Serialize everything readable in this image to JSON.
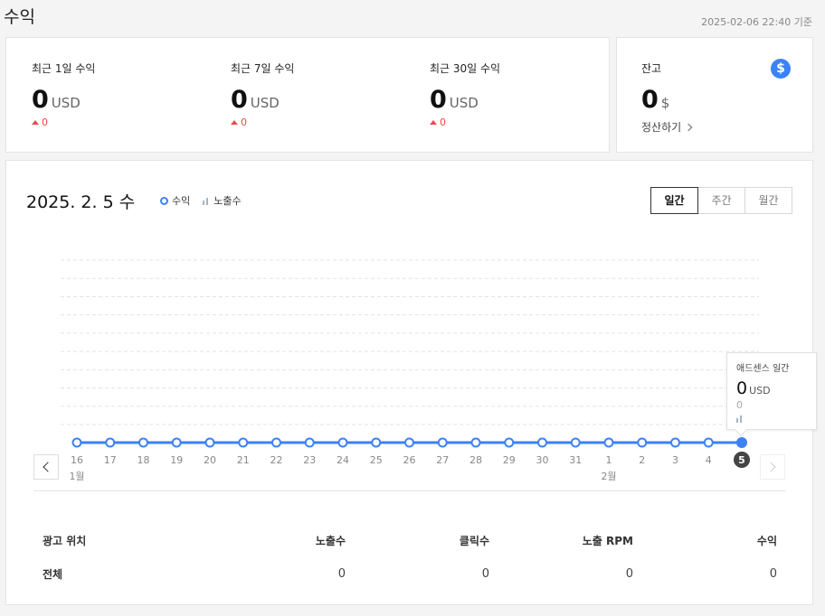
{
  "page": {
    "title": "수익",
    "updated": "2025-02-06 22:40 기준"
  },
  "summary": [
    {
      "label": "최근 1일 수익",
      "value": "0",
      "unit": "USD",
      "delta": "0"
    },
    {
      "label": "최근 7일 수익",
      "value": "0",
      "unit": "USD",
      "delta": "0"
    },
    {
      "label": "최근 30일 수익",
      "value": "0",
      "unit": "USD",
      "delta": "0"
    }
  ],
  "balance": {
    "label": "잔고",
    "value": "0",
    "unit": "$",
    "settle_label": "정산하기",
    "icon_glyph": "$"
  },
  "main": {
    "date": "2025. 2. 5 수",
    "legend": {
      "revenue": "수익",
      "impressions": "노출수"
    },
    "periods": [
      "일간",
      "주간",
      "월간"
    ],
    "active_period": "일간"
  },
  "chart_data": {
    "type": "line",
    "categories": [
      "16",
      "17",
      "18",
      "19",
      "20",
      "21",
      "22",
      "23",
      "24",
      "25",
      "26",
      "27",
      "28",
      "29",
      "30",
      "31",
      "1",
      "2",
      "3",
      "4",
      "5"
    ],
    "month_labels": [
      {
        "at": "16",
        "label": "1월"
      },
      {
        "at": "1",
        "label": "2월"
      }
    ],
    "series": [
      {
        "name": "수익",
        "values": [
          0,
          0,
          0,
          0,
          0,
          0,
          0,
          0,
          0,
          0,
          0,
          0,
          0,
          0,
          0,
          0,
          0,
          0,
          0,
          0,
          0
        ]
      },
      {
        "name": "노출수",
        "values": [
          0,
          0,
          0,
          0,
          0,
          0,
          0,
          0,
          0,
          0,
          0,
          0,
          0,
          0,
          0,
          0,
          0,
          0,
          0,
          0,
          0
        ]
      }
    ],
    "selected": "5",
    "grid": true,
    "colors": {
      "line": "#3b82f6",
      "grid": "#e3e3e3",
      "selected_badge": "#444444"
    }
  },
  "tooltip": {
    "title": "애드센스 일간",
    "value": "0",
    "unit": "USD",
    "impressions": "0"
  },
  "table": {
    "headers": [
      "광고 위치",
      "노출수",
      "클릭수",
      "노출 RPM",
      "수익"
    ],
    "rows": [
      [
        "전체",
        "0",
        "0",
        "0",
        "0"
      ]
    ]
  }
}
